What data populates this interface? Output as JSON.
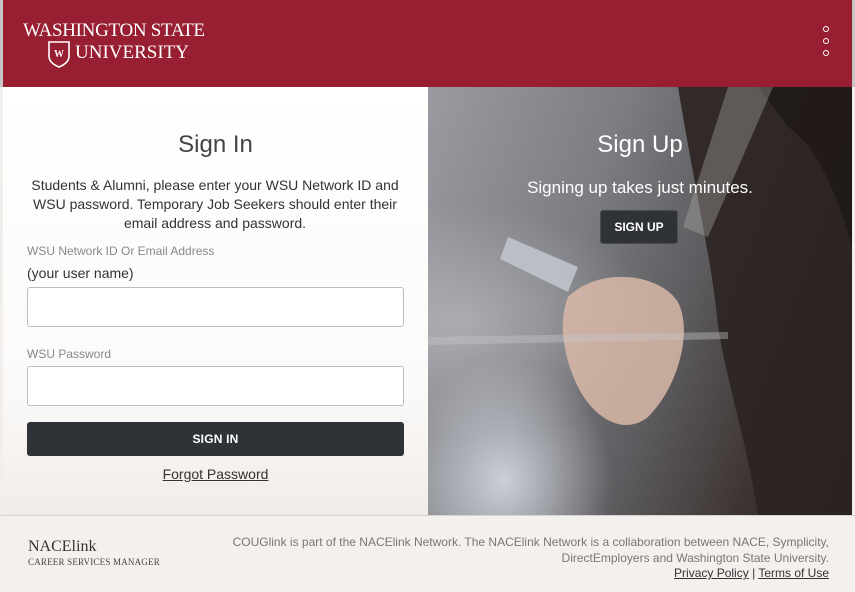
{
  "header": {
    "logo_line1": "WASHINGTON STATE",
    "logo_line2": "UNIVERSITY",
    "brand_color": "#981e32",
    "menu_icon": "kebab-menu-icon"
  },
  "signin": {
    "title": "Sign In",
    "description": "Students & Alumni, please enter your WSU Network ID and WSU password. Temporary Job Seekers should enter their email address and password.",
    "username_label": "WSU Network ID Or Email Address",
    "username_hint": "(your user name)",
    "username_value": "",
    "password_label": "WSU Password",
    "password_value": "",
    "button_label": "SIGN IN",
    "forgot_label": "Forgot Password"
  },
  "signup": {
    "title": "Sign Up",
    "subtitle": "Signing up takes just minutes.",
    "button_label": "SIGN UP"
  },
  "footer": {
    "nace_logo_text": "NACElink",
    "nace_logo_sub": "CAREER SERVICES MANAGER",
    "text": "COUGlink is part of the NACElink Network. The NACElink Network is a collaboration between NACE, Symplicity, DirectEmployers and Washington State University.",
    "privacy_label": "Privacy Policy",
    "separator": "|",
    "terms_label": "Terms of Use"
  },
  "colors": {
    "dark_button": "#2f3236",
    "page_background": "#f2eeec"
  }
}
